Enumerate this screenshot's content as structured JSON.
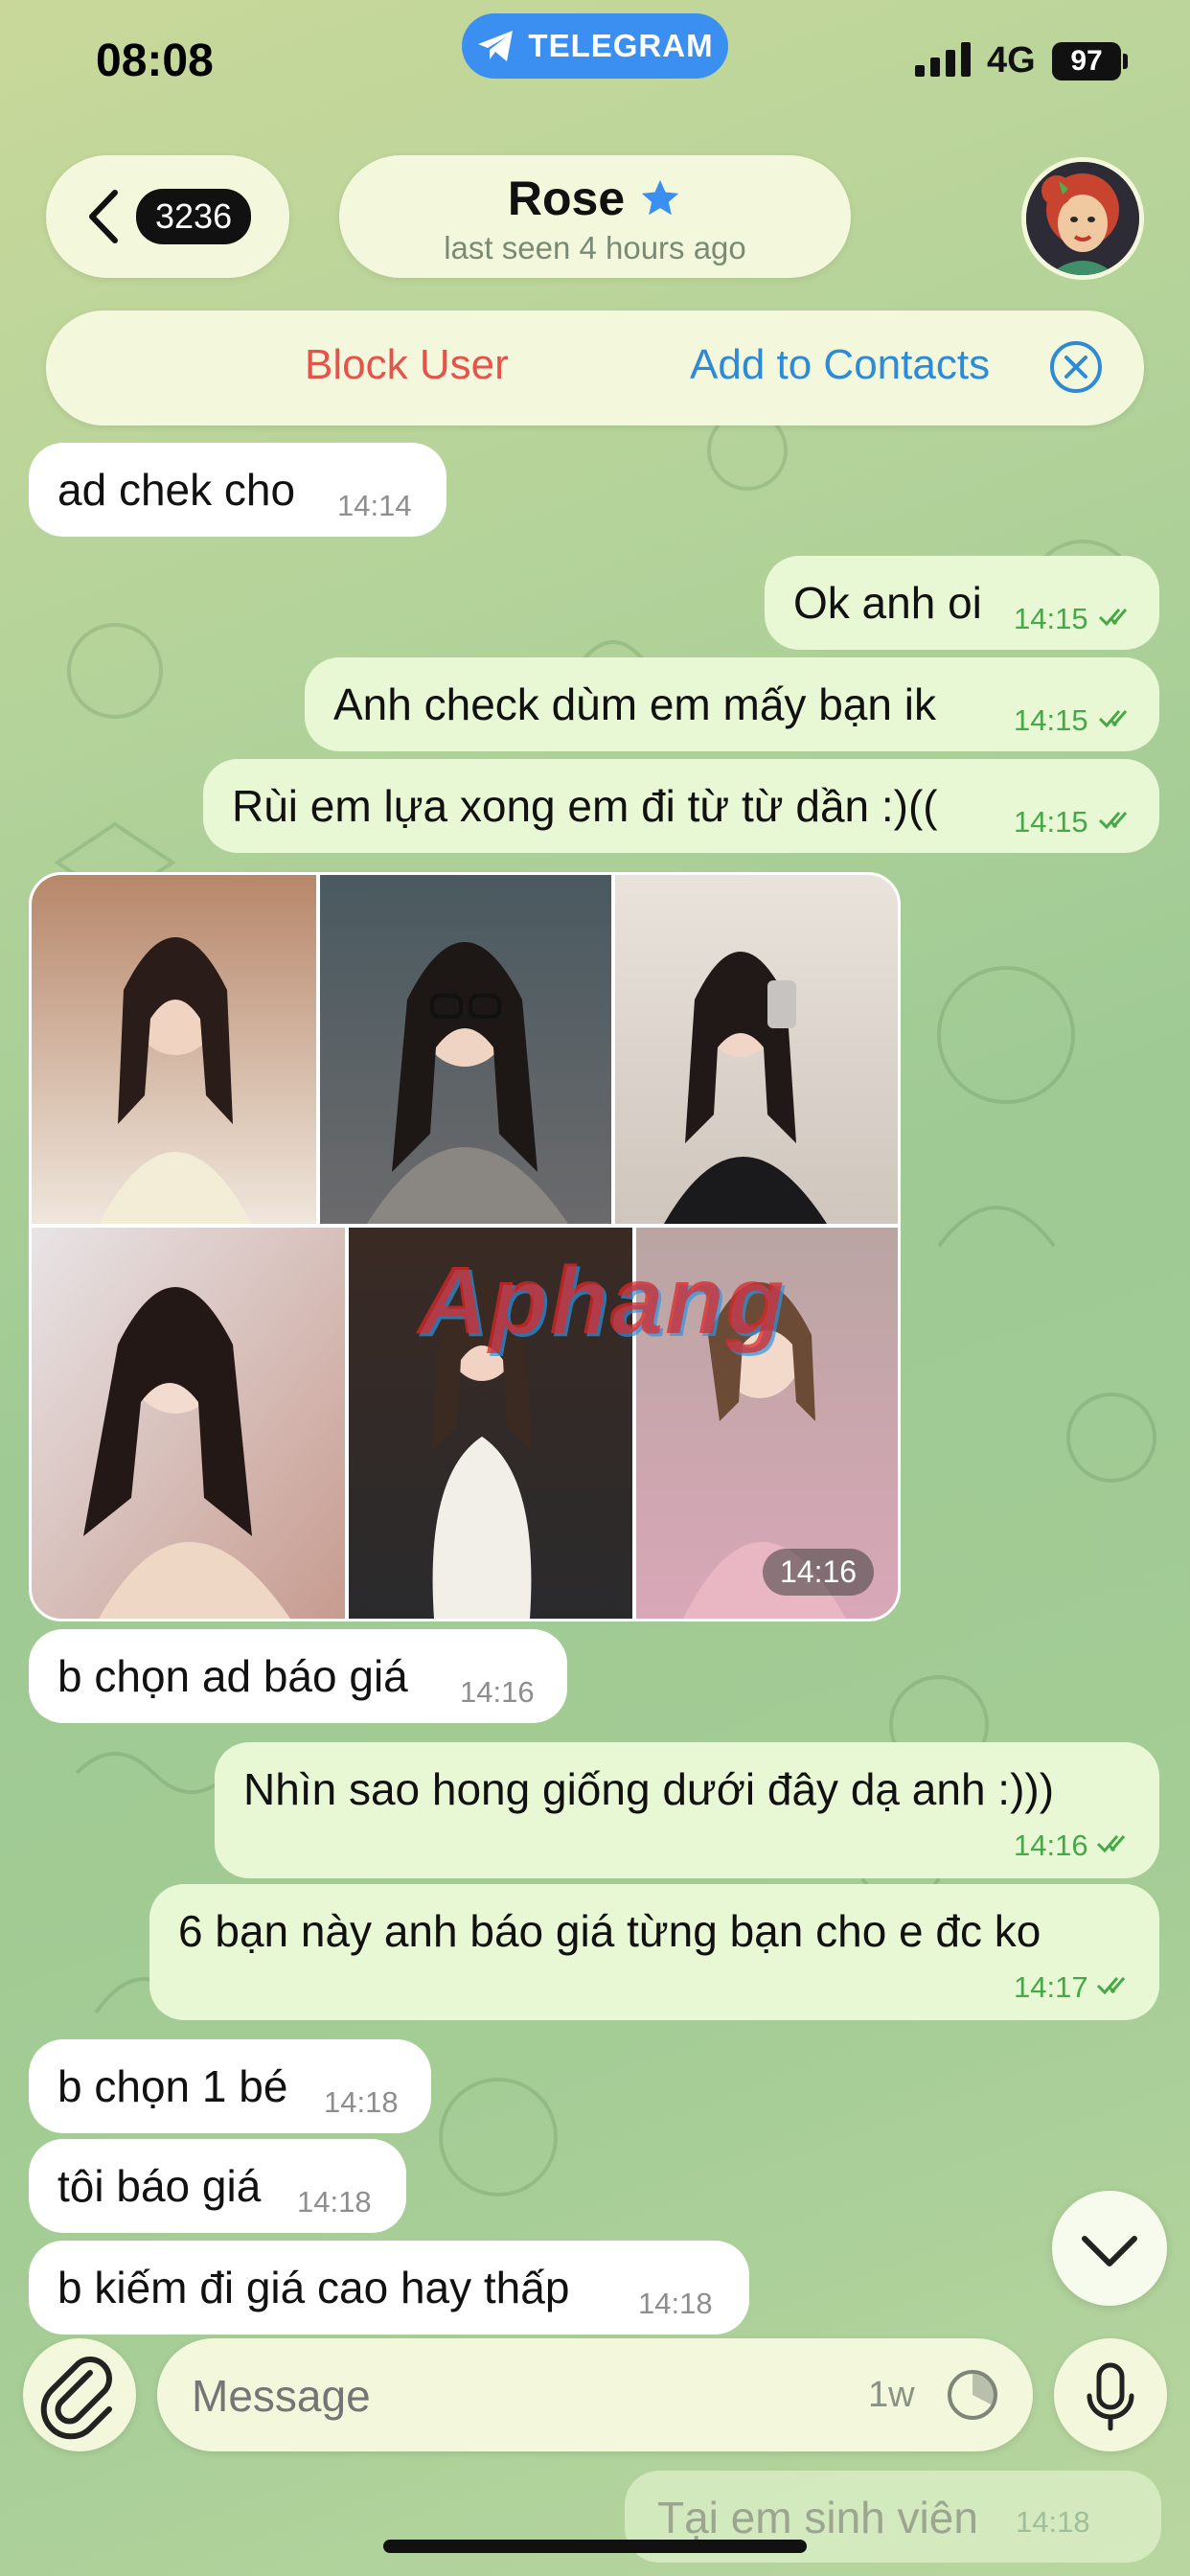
{
  "status_bar": {
    "time": "08:08",
    "app_pill": "TELEGRAM",
    "network": "4G",
    "battery": "97"
  },
  "header": {
    "unread_count": "3236",
    "contact_name": "Rose",
    "last_seen": "last seen 4 hours ago"
  },
  "actions": {
    "block_user": "Block User",
    "add_to_contacts": "Add to Contacts"
  },
  "messages": [
    {
      "dir": "in",
      "text": "ad chek cho",
      "time": "14:14"
    },
    {
      "dir": "out",
      "text": "Ok anh oi",
      "time": "14:15"
    },
    {
      "dir": "out",
      "text": "Anh check dùm em mấy bạn ik",
      "time": "14:15"
    },
    {
      "dir": "out",
      "text": "Rùi em lựa xong em đi từ từ dần :)((",
      "time": "14:15"
    },
    {
      "dir": "in",
      "text": "b chọn ad báo giá",
      "time": "14:16"
    },
    {
      "dir": "out",
      "text": "Nhìn sao hong giống dưới đây dạ anh :)))",
      "time": "14:16"
    },
    {
      "dir": "out",
      "text": "6 bạn này anh báo giá từng bạn cho e đc ko",
      "time": "14:17"
    },
    {
      "dir": "in",
      "text": "b chọn 1 bé",
      "time": "14:18"
    },
    {
      "dir": "in",
      "text": "tôi báo giá",
      "time": "14:18"
    },
    {
      "dir": "in",
      "text": "b kiếm đi giá cao hay thấp",
      "time": "14:18"
    }
  ],
  "album": {
    "time": "14:16",
    "watermark": "Aphang",
    "photo_count": 6
  },
  "composer": {
    "placeholder": "Message",
    "timer_label": "1w"
  },
  "ghost_message": {
    "text": "Tại em sinh viên",
    "time": "14:18"
  },
  "colors": {
    "incoming_bubble": "#ffffff",
    "outgoing_bubble": "#e8f8d4",
    "outgoing_time": "#46a846",
    "block_red": "#e5534b",
    "link_blue": "#2e8ad6",
    "telegram_blue": "#3a8ff0"
  }
}
